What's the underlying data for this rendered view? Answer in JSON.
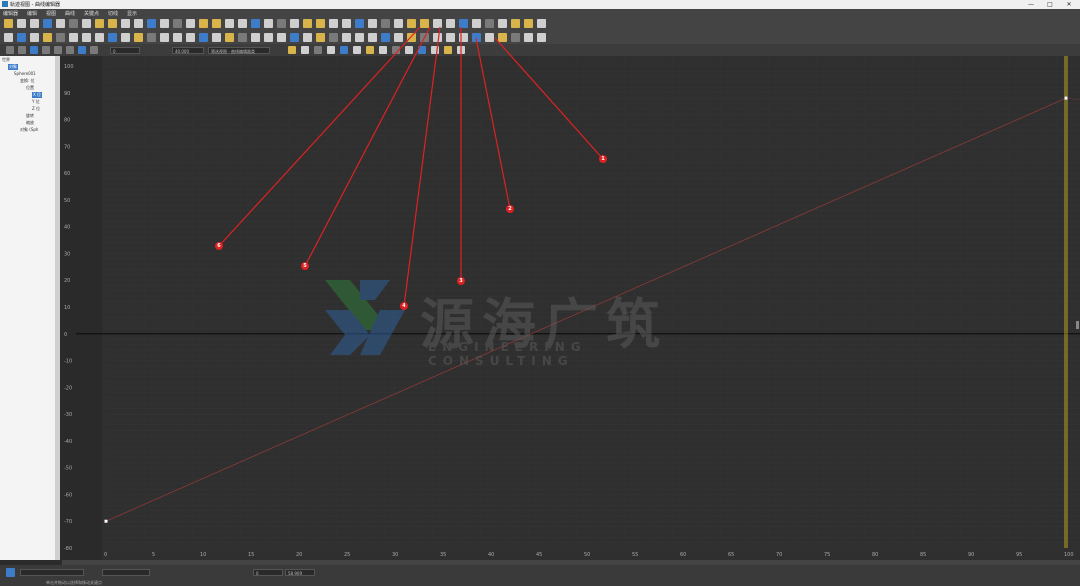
{
  "window": {
    "title": "轨迹视图 - 曲线编辑器",
    "minimize": "—",
    "maximize": "□",
    "close": "✕"
  },
  "menu": [
    "编辑器",
    "编辑",
    "视图",
    "曲线",
    "关键点",
    "切线",
    "显示"
  ],
  "toolbar_fields": {
    "frame_value": "0",
    "value_field": "40.000",
    "filter_dropdown": "筛选视图 - 曲线编辑器类"
  },
  "tree": {
    "root": "世界",
    "items": [
      {
        "label": "对象",
        "selected": true
      },
      {
        "label": "Sphere001"
      },
      {
        "label": "变换: 位"
      },
      {
        "label": "位置"
      },
      {
        "label": "X 位",
        "selected": true
      },
      {
        "label": "Y 位"
      },
      {
        "label": "Z 位"
      },
      {
        "label": "旋转"
      },
      {
        "label": "缩放"
      },
      {
        "label": "对象 (Sph"
      }
    ]
  },
  "graph": {
    "y_ticks": [
      "100",
      "90",
      "80",
      "70",
      "60",
      "50",
      "40",
      "30",
      "20",
      "10",
      "0",
      "-10",
      "-20",
      "-30",
      "-40",
      "-50",
      "-60",
      "-70",
      "-80"
    ],
    "x_ticks": [
      "0",
      "5",
      "10",
      "15",
      "20",
      "25",
      "30",
      "35",
      "40",
      "45",
      "50",
      "55",
      "60",
      "65",
      "70",
      "75",
      "80",
      "85",
      "90",
      "95",
      "100"
    ],
    "curve_start": [
      0,
      -70
    ],
    "curve_end": [
      100,
      88
    ],
    "current_frame": 100
  },
  "callouts": [
    "1",
    "2",
    "3",
    "4",
    "5",
    "6"
  ],
  "watermark": {
    "cn": "源海广筑",
    "en": "ENGINEERING CONSULTING"
  },
  "statusbar": {
    "text": "单击并拖动以选择和移动关键点",
    "frame": "0",
    "value": "58.909"
  }
}
